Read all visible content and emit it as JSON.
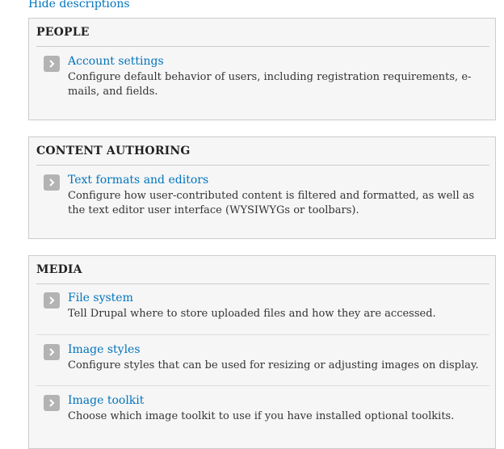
{
  "toggle_link": "Hide descriptions",
  "panels": [
    {
      "title": "PEOPLE",
      "items": [
        {
          "title": "Account settings",
          "description": "Configure default behavior of users, including registration requirements, e-mails, and fields."
        }
      ]
    },
    {
      "title": "CONTENT AUTHORING",
      "items": [
        {
          "title": "Text formats and editors",
          "description": "Configure how user-contributed content is filtered and formatted, as well as the text editor user interface (WYSIWYGs or toolbars)."
        }
      ]
    },
    {
      "title": "MEDIA",
      "items": [
        {
          "title": "File system",
          "description": "Tell Drupal where to store uploaded files and how they are accessed."
        },
        {
          "title": "Image styles",
          "description": "Configure styles that can be used for resizing or adjusting images on display."
        },
        {
          "title": "Image toolkit",
          "description": "Choose which image toolkit to use if you have installed optional toolkits."
        }
      ]
    }
  ]
}
